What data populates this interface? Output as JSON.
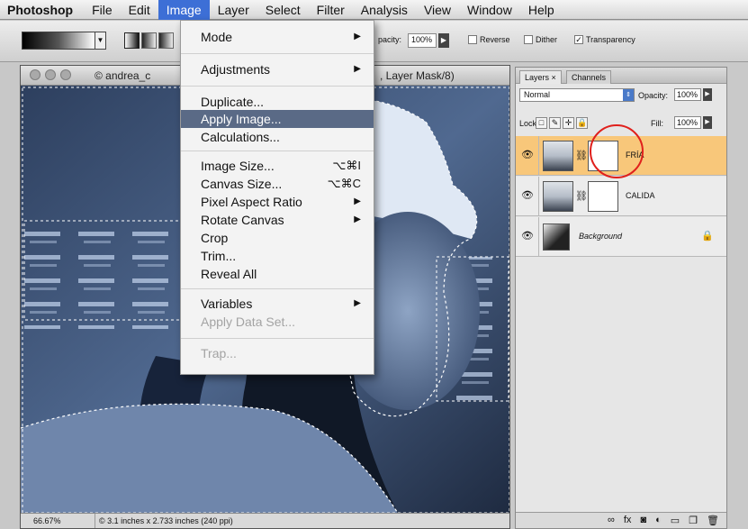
{
  "menubar": {
    "items": [
      {
        "label": "Photoshop",
        "app": true
      },
      {
        "label": "File"
      },
      {
        "label": "Edit"
      },
      {
        "label": "Image",
        "active": true
      },
      {
        "label": "Layer"
      },
      {
        "label": "Select"
      },
      {
        "label": "Filter"
      },
      {
        "label": "Analysis"
      },
      {
        "label": "View"
      },
      {
        "label": "Window"
      },
      {
        "label": "Help"
      }
    ]
  },
  "options": {
    "opacity_label": "pacity:",
    "opacity_value": "100%",
    "reverse_label": "Reverse",
    "dither_label": "Dither",
    "transparency_label": "Transparency",
    "transparency_checked": true
  },
  "document": {
    "title_left": "© andrea_c",
    "title_right": ", Layer Mask/8)",
    "zoom": "66.67%",
    "info": "© 3.1 inches x 2.733 inches (240 ppi)"
  },
  "image_menu": {
    "items": [
      {
        "label": "Mode",
        "submenu": true
      },
      {
        "label": "Adjustments",
        "submenu": true
      },
      {
        "label": "Duplicate..."
      },
      {
        "label": "Apply Image...",
        "highlighted": true
      },
      {
        "label": "Calculations..."
      },
      {
        "label": "Image Size...",
        "shortcut": "⌥⌘I"
      },
      {
        "label": "Canvas Size...",
        "shortcut": "⌥⌘C"
      },
      {
        "label": "Pixel Aspect Ratio",
        "submenu": true
      },
      {
        "label": "Rotate Canvas",
        "submenu": true
      },
      {
        "label": "Crop"
      },
      {
        "label": "Trim..."
      },
      {
        "label": "Reveal All"
      },
      {
        "label": "Variables",
        "submenu": true
      },
      {
        "label": "Apply Data Set...",
        "disabled": true
      },
      {
        "label": "Trap...",
        "disabled": true
      }
    ]
  },
  "layers_panel": {
    "tabs": [
      "Layers ×",
      "Channels"
    ],
    "blend_mode": "Normal",
    "opacity_label": "Opacity:",
    "opacity_value": "100%",
    "lock_label": "Lock:",
    "fill_label": "Fill:",
    "fill_value": "100%",
    "layers": [
      {
        "name": "FRÍA",
        "selected": true,
        "has_mask": true
      },
      {
        "name": "CALIDA",
        "selected": false,
        "has_mask": true
      },
      {
        "name": "Background",
        "selected": false,
        "has_mask": false,
        "locked": true
      }
    ]
  },
  "colors": {
    "menu_highlight": "#5a6a86",
    "menubar_active": "#3d6fd6",
    "selected_layer": "#f8c77a",
    "annotation_circle": "#e0201c"
  }
}
